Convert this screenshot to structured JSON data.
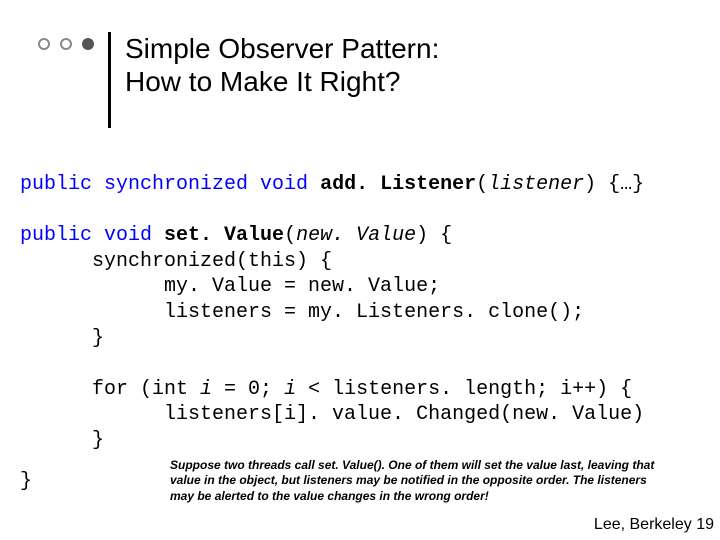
{
  "title": {
    "line1": "Simple Observer Pattern:",
    "line2": "How to Make It Right?"
  },
  "code": {
    "l1a": "public synchronized void ",
    "l1b": "add. Listener",
    "l1c": "(",
    "l1d": "listener",
    "l1e": ") {…}",
    "l2a": "public void ",
    "l2b": "set. Value",
    "l2c": "(",
    "l2d": "new. Value",
    "l2e": ") {",
    "l3": "      synchronized(this) {",
    "l4": "            my. Value = new. Value;",
    "l5": "            listeners = my. Listeners. clone();",
    "l6": "      }",
    "l7a": "      for (int ",
    "l7b": "i",
    "l7c": " = 0; ",
    "l7d": "i",
    "l7e": " < listeners. length; i++) {",
    "l8": "            listeners[i]. value. Changed(new. Value)",
    "l9": "      }",
    "l10": "}"
  },
  "note": "Suppose two threads call set. Value(). One of them will set the value last, leaving that value in the object, but listeners may be notified in the opposite order. The listeners may be alerted to the value changes in the wrong order!",
  "footer": "Lee, Berkeley 19"
}
